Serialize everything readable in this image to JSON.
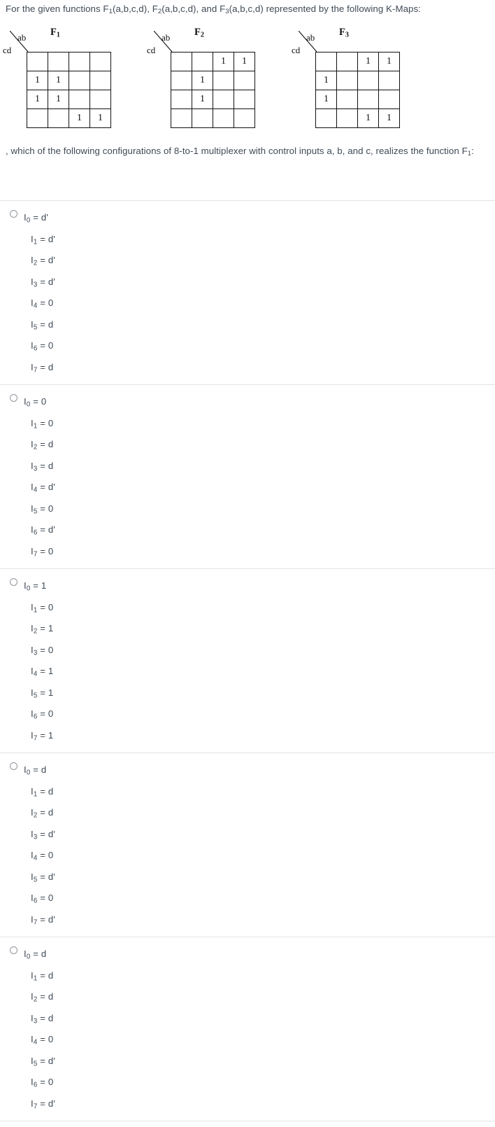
{
  "question": {
    "intro_prefix": "For the given functions ",
    "intro_parts": [
      "F",
      "1",
      "(a,b,c,d), ",
      "F",
      "2",
      "(a,b,c,d), and ",
      "F",
      "3",
      "(a,b,c,d) represented by the following K-Maps:"
    ],
    "intro_full": "For the given functions F1(a,b,c,d), F2(a,b,c,d), and F3(a,b,c,d) represented by the following K-Maps:",
    "tail_before": ", which of the following configurations of 8-to-1 multiplexer with control inputs a, b, and c, realizes the function F",
    "tail_sub": "1",
    "tail_after": ":"
  },
  "kmaps": [
    {
      "title_base": "F",
      "title_sub": "1",
      "row_label": "cd",
      "col_label": "ab",
      "cells": [
        [
          "",
          "",
          "",
          ""
        ],
        [
          "1",
          "1",
          "",
          ""
        ],
        [
          "1",
          "1",
          "",
          ""
        ],
        [
          "",
          "",
          "1",
          "1"
        ]
      ]
    },
    {
      "title_base": "F",
      "title_sub": "2",
      "row_label": "cd",
      "col_label": "ab",
      "cells": [
        [
          "",
          "",
          "1",
          "1"
        ],
        [
          "",
          "1",
          "",
          ""
        ],
        [
          "",
          "1",
          "",
          ""
        ],
        [
          "",
          "",
          "",
          ""
        ]
      ]
    },
    {
      "title_base": "F",
      "title_sub": "3",
      "row_label": "cd",
      "col_label": "ab",
      "cells": [
        [
          "",
          "",
          "1",
          "1"
        ],
        [
          "1",
          "",
          "",
          ""
        ],
        [
          "1",
          "",
          "",
          ""
        ],
        [
          "",
          "",
          "1",
          "1"
        ]
      ]
    }
  ],
  "options": [
    {
      "selected": false,
      "lines": [
        {
          "base": "I",
          "sub": "0",
          "value": "d'"
        },
        {
          "base": "I",
          "sub": "1",
          "value": "d'"
        },
        {
          "base": "I",
          "sub": "2",
          "value": "d'"
        },
        {
          "base": "I",
          "sub": "3",
          "value": "d'"
        },
        {
          "base": "I",
          "sub": "4",
          "value": "0"
        },
        {
          "base": "I",
          "sub": "5",
          "value": "d"
        },
        {
          "base": "I",
          "sub": "6",
          "value": "0"
        },
        {
          "base": "I",
          "sub": "7",
          "value": "d"
        }
      ]
    },
    {
      "selected": false,
      "lines": [
        {
          "base": "I",
          "sub": "0",
          "value": "0"
        },
        {
          "base": "I",
          "sub": "1",
          "value": "0"
        },
        {
          "base": "I",
          "sub": "2",
          "value": "d"
        },
        {
          "base": "I",
          "sub": "3",
          "value": "d"
        },
        {
          "base": "I",
          "sub": "4",
          "value": "d'"
        },
        {
          "base": "I",
          "sub": "5",
          "value": "0"
        },
        {
          "base": "I",
          "sub": "6",
          "value": "d'"
        },
        {
          "base": "I",
          "sub": "7",
          "value": "0"
        }
      ]
    },
    {
      "selected": false,
      "lines": [
        {
          "base": "I",
          "sub": "0",
          "value": "1"
        },
        {
          "base": "I",
          "sub": "1",
          "value": "0"
        },
        {
          "base": "I",
          "sub": "2",
          "value": "1"
        },
        {
          "base": "I",
          "sub": "3",
          "value": "0"
        },
        {
          "base": "I",
          "sub": "4",
          "value": "1"
        },
        {
          "base": "I",
          "sub": "5",
          "value": "1"
        },
        {
          "base": "I",
          "sub": "6",
          "value": "0"
        },
        {
          "base": "I",
          "sub": "7",
          "value": "1"
        }
      ]
    },
    {
      "selected": false,
      "lines": [
        {
          "base": "I",
          "sub": "0",
          "value": "d"
        },
        {
          "base": "I",
          "sub": "1",
          "value": "d"
        },
        {
          "base": "I",
          "sub": "2",
          "value": "d"
        },
        {
          "base": "I",
          "sub": "3",
          "value": "d'"
        },
        {
          "base": "I",
          "sub": "4",
          "value": "0"
        },
        {
          "base": "I",
          "sub": "5",
          "value": "d'"
        },
        {
          "base": "I",
          "sub": "6",
          "value": "0"
        },
        {
          "base": "I",
          "sub": "7",
          "value": "d'"
        }
      ]
    },
    {
      "selected": false,
      "lines": [
        {
          "base": "I",
          "sub": "0",
          "value": "d"
        },
        {
          "base": "I",
          "sub": "1",
          "value": "d"
        },
        {
          "base": "I",
          "sub": "2",
          "value": "d"
        },
        {
          "base": "I",
          "sub": "3",
          "value": "d"
        },
        {
          "base": "I",
          "sub": "4",
          "value": "0"
        },
        {
          "base": "I",
          "sub": "5",
          "value": "d'"
        },
        {
          "base": "I",
          "sub": "6",
          "value": "0"
        },
        {
          "base": "I",
          "sub": "7",
          "value": "d'"
        }
      ]
    }
  ],
  "colors": {
    "text": "#3f4a56",
    "divider": "#e2e4e6",
    "radio_border": "#90959b",
    "kmap_line": "#111111"
  }
}
